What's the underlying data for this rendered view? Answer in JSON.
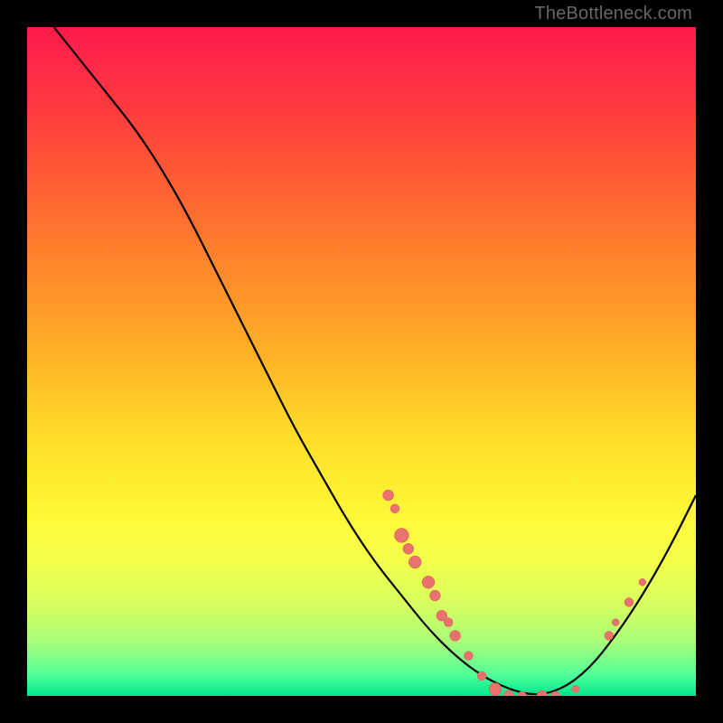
{
  "watermark": "TheBottleneck.com",
  "colors": {
    "gradient_top": "#ff1a4d",
    "gradient_bottom": "#00e58c",
    "curve": "#000000",
    "dot_fill": "#e8736c",
    "dot_stroke": "#d85f58"
  },
  "chart_data": {
    "type": "line",
    "title": "",
    "xlabel": "",
    "ylabel": "",
    "xlim": [
      0,
      100
    ],
    "ylim": [
      0,
      100
    ],
    "axes_visible": false,
    "curve": [
      {
        "x": 4,
        "y": 100
      },
      {
        "x": 8,
        "y": 95
      },
      {
        "x": 12,
        "y": 90
      },
      {
        "x": 16,
        "y": 85
      },
      {
        "x": 20,
        "y": 79
      },
      {
        "x": 24,
        "y": 72
      },
      {
        "x": 28,
        "y": 64
      },
      {
        "x": 32,
        "y": 56
      },
      {
        "x": 36,
        "y": 48
      },
      {
        "x": 40,
        "y": 40
      },
      {
        "x": 44,
        "y": 33
      },
      {
        "x": 48,
        "y": 26
      },
      {
        "x": 52,
        "y": 20
      },
      {
        "x": 56,
        "y": 15
      },
      {
        "x": 60,
        "y": 10
      },
      {
        "x": 64,
        "y": 6
      },
      {
        "x": 68,
        "y": 3
      },
      {
        "x": 72,
        "y": 1
      },
      {
        "x": 76,
        "y": 0
      },
      {
        "x": 80,
        "y": 1
      },
      {
        "x": 84,
        "y": 4
      },
      {
        "x": 88,
        "y": 9
      },
      {
        "x": 92,
        "y": 15
      },
      {
        "x": 96,
        "y": 22
      },
      {
        "x": 100,
        "y": 30
      }
    ],
    "scatter_points": [
      {
        "x": 54,
        "y": 30,
        "r": 6
      },
      {
        "x": 55,
        "y": 28,
        "r": 5
      },
      {
        "x": 56,
        "y": 24,
        "r": 8
      },
      {
        "x": 57,
        "y": 22,
        "r": 6
      },
      {
        "x": 58,
        "y": 20,
        "r": 7
      },
      {
        "x": 60,
        "y": 17,
        "r": 7
      },
      {
        "x": 61,
        "y": 15,
        "r": 6
      },
      {
        "x": 62,
        "y": 12,
        "r": 6
      },
      {
        "x": 63,
        "y": 11,
        "r": 5
      },
      {
        "x": 64,
        "y": 9,
        "r": 6
      },
      {
        "x": 66,
        "y": 6,
        "r": 5
      },
      {
        "x": 68,
        "y": 3,
        "r": 5
      },
      {
        "x": 70,
        "y": 1,
        "r": 7
      },
      {
        "x": 72,
        "y": 0,
        "r": 6
      },
      {
        "x": 74,
        "y": 0,
        "r": 5
      },
      {
        "x": 77,
        "y": 0,
        "r": 6
      },
      {
        "x": 79,
        "y": 0,
        "r": 5
      },
      {
        "x": 82,
        "y": 1,
        "r": 4
      },
      {
        "x": 87,
        "y": 9,
        "r": 5
      },
      {
        "x": 88,
        "y": 11,
        "r": 4
      },
      {
        "x": 90,
        "y": 14,
        "r": 5
      },
      {
        "x": 92,
        "y": 17,
        "r": 4
      }
    ]
  }
}
